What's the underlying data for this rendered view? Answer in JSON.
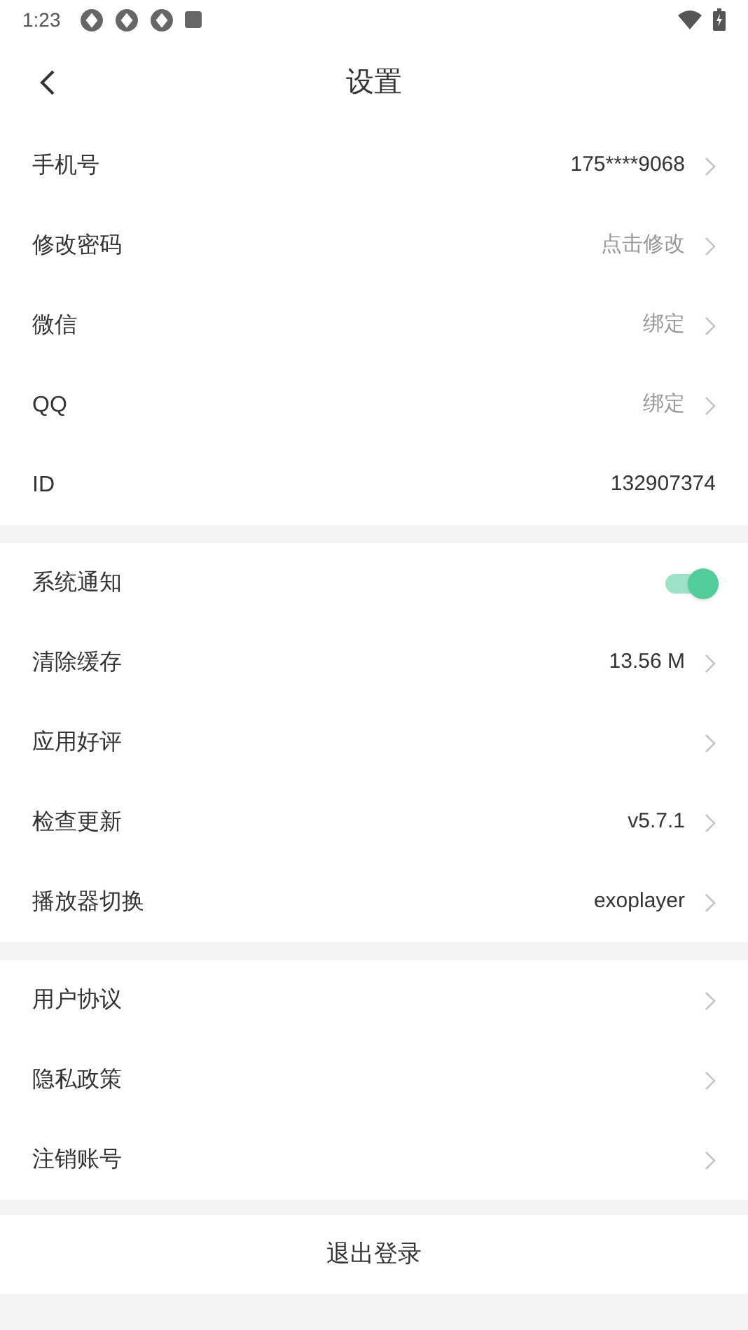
{
  "status_bar": {
    "time": "1:23"
  },
  "title_bar": {
    "title": "设置"
  },
  "sections": [
    {
      "rows": [
        {
          "kind": "link",
          "label": "手机号",
          "value": "175****9068",
          "value_muted": false
        },
        {
          "kind": "link",
          "label": "修改密码",
          "value": "点击修改",
          "value_muted": true
        },
        {
          "kind": "link",
          "label": "微信",
          "value": "绑定",
          "value_muted": true
        },
        {
          "kind": "link",
          "label": "QQ",
          "value": "绑定",
          "value_muted": true
        },
        {
          "kind": "plain",
          "label": "ID",
          "value": "132907374",
          "value_muted": false
        }
      ]
    },
    {
      "rows": [
        {
          "kind": "toggle",
          "label": "系统通知",
          "on": true
        },
        {
          "kind": "link",
          "label": "清除缓存",
          "value": "13.56 M",
          "value_muted": false
        },
        {
          "kind": "link",
          "label": "应用好评"
        },
        {
          "kind": "link",
          "label": "检查更新",
          "value": "v5.7.1",
          "value_muted": false
        },
        {
          "kind": "link",
          "label": "播放器切换",
          "value": "exoplayer",
          "value_muted": false
        }
      ]
    },
    {
      "rows": [
        {
          "kind": "link",
          "label": "用户协议"
        },
        {
          "kind": "link",
          "label": "隐私政策"
        },
        {
          "kind": "link",
          "label": "注销账号"
        }
      ]
    }
  ],
  "logout_button": "退出登录"
}
